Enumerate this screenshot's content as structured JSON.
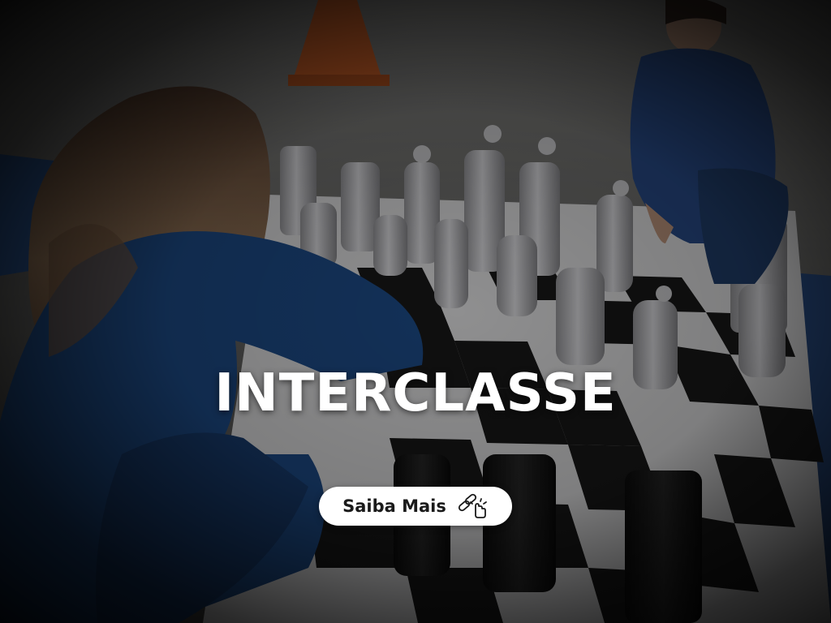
{
  "banner": {
    "title": "INTERCLASSE",
    "cta_label": "Saiba Mais",
    "cta_icon": "link-click-icon"
  },
  "photo": {
    "description_icon": "chess-board-photo"
  },
  "colors": {
    "text": "#ffffff",
    "button_bg": "#ffffff",
    "button_text": "#1a1a1a",
    "uniform": "#1f4f8f"
  }
}
